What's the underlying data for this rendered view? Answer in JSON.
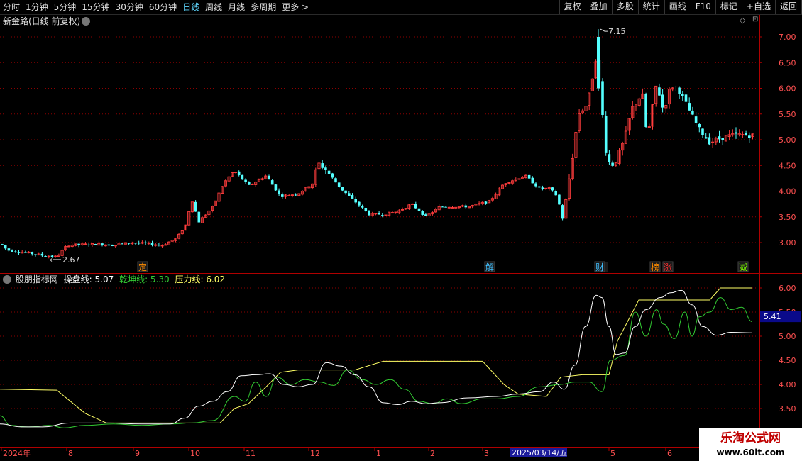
{
  "toolbar": {
    "periods": [
      "分时",
      "1分钟",
      "5分钟",
      "15分钟",
      "30分钟",
      "60分钟",
      "日线",
      "周线",
      "月线",
      "多周期",
      "更多 >"
    ],
    "active_period": "日线",
    "buttons": [
      "复权",
      "叠加",
      "多股",
      "统计",
      "画线",
      "F10",
      "标记",
      "+自选",
      "返回"
    ]
  },
  "main_chart": {
    "title": "新金路(日线 前复权)",
    "y_ticks": [
      "7.00",
      "6.50",
      "6.00",
      "5.50",
      "5.00",
      "4.50",
      "4.00",
      "3.50",
      "3.00"
    ],
    "high_label": "7.15",
    "low_label": "2.67",
    "event_markers": [
      {
        "text": "定",
        "color": "#ff8c00"
      },
      {
        "text": "解",
        "color": "#40c0ff"
      },
      {
        "text": "财",
        "color": "#40c0ff"
      },
      {
        "text": "榜",
        "color": "#ff8c00"
      },
      {
        "text": "涨",
        "color": "#ff3030"
      },
      {
        "text": "减",
        "color": "#7cfc00"
      }
    ]
  },
  "indicator": {
    "name": "股朋指标网",
    "line1_label": "操盘线: 5.07",
    "line2_label": "乾坤线: 5.30",
    "line3_label": "压力线: 6.02",
    "line1_color": "#ffffff",
    "line2_color": "#33cc33",
    "line3_color": "#ffff66",
    "y_ticks": [
      "6.00",
      "5.50",
      "5.00",
      "4.50",
      "4.00",
      "3.50"
    ],
    "current_value": "5.41"
  },
  "x_axis": {
    "labels": [
      "2024年",
      "8",
      "9",
      "10",
      "11",
      "12",
      "1",
      "2",
      "3",
      "4",
      "5",
      "6"
    ],
    "highlight_date": "2025/03/14/五"
  },
  "watermark": {
    "line1": "乐淘公式网",
    "line2": "www.60lt.com"
  },
  "colors": {
    "up": "#ff3c3c",
    "down": "#54ffff",
    "grid": "#8b0000",
    "axis": "#b00000"
  }
}
